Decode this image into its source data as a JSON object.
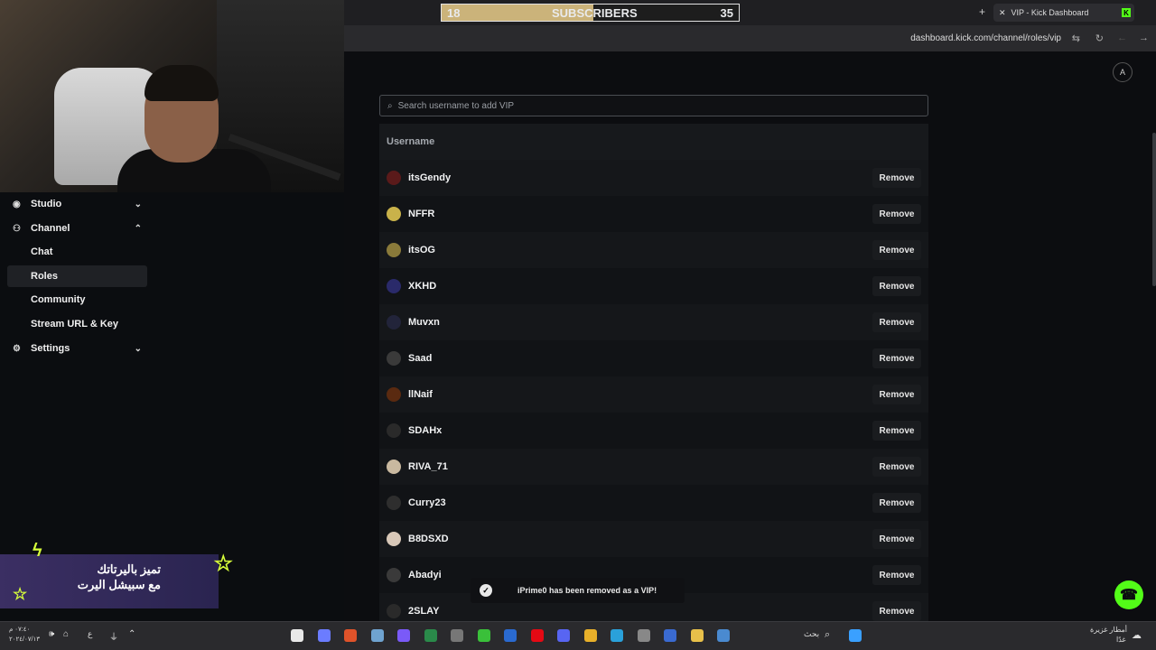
{
  "overlay": {
    "sub_left": "18",
    "sub_label": "SUBSCRIBERS",
    "sub_right": "35",
    "progress": 0.51
  },
  "browser": {
    "tab_title": "VIP - Kick Dashboard",
    "url": "dashboard.kick.com/channel/roles/vip",
    "new_tab": "+",
    "close": "✕",
    "kick_logo": "K"
  },
  "sidebar": {
    "items": [
      {
        "label": "Studio",
        "icon": "studio-icon",
        "chevron": "down"
      },
      {
        "label": "Channel",
        "icon": "channel-icon",
        "chevron": "up"
      },
      {
        "label": "Chat"
      },
      {
        "label": "Roles",
        "active": true
      },
      {
        "label": "Community"
      },
      {
        "label": "Stream URL & Key"
      },
      {
        "label": "Settings",
        "icon": "gear-icon",
        "chevron": "down"
      }
    ]
  },
  "search": {
    "placeholder": "Search username to add VIP"
  },
  "table": {
    "header": "Username",
    "remove_label": "Remove",
    "rows": [
      {
        "name": "itsGendy",
        "color": "#5a1a1a"
      },
      {
        "name": "NFFR",
        "color": "#c9b24a"
      },
      {
        "name": "itsOG",
        "color": "#8a7a3a"
      },
      {
        "name": "XKHD",
        "color": "#2a2a6a"
      },
      {
        "name": "Muvxn",
        "color": "#22243a"
      },
      {
        "name": "Saad",
        "color": "#3a3a3a"
      },
      {
        "name": "llNaif",
        "color": "#5a2a10"
      },
      {
        "name": "SDAHx",
        "color": "#2a2a2a"
      },
      {
        "name": "RIVA_71",
        "color": "#c9b9a0"
      },
      {
        "name": "Curry23",
        "color": "#2e2e2e"
      },
      {
        "name": "B8DSXD",
        "color": "#d8c8b8"
      },
      {
        "name": "Abadyi",
        "color": "#3a3a3a"
      },
      {
        "name": "2SLAY",
        "color": "#2a2a2a"
      }
    ]
  },
  "toast": {
    "message": "iPrime0 has been removed as a VIP!"
  },
  "promo": {
    "line1": "تميز باليرتاتك",
    "line2": "مع سبيشل اليرت"
  },
  "taskbar": {
    "search_label": "بحث",
    "weather": "أمطار غزيرة",
    "weather_sub": "غدًا",
    "time": "٠٧:٤٠ م",
    "date": "٢٠٢٤/٠٧/١٣",
    "lang": "ع"
  },
  "colors": {
    "kick_green": "#53fc18",
    "bg": "#0b0d10"
  }
}
